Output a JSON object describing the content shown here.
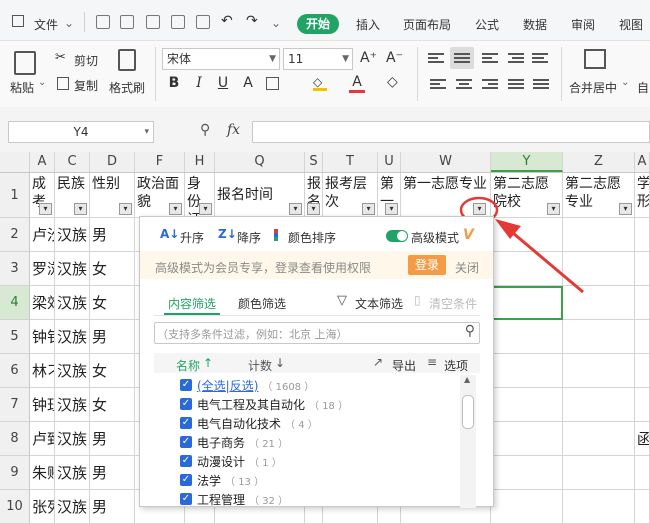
{
  "menubar": {
    "file_label": "文件",
    "tabs": [
      "开始",
      "插入",
      "页面布局",
      "公式",
      "数据",
      "审阅",
      "视图"
    ]
  },
  "ribbon": {
    "paste": "粘贴",
    "cut": "剪切",
    "copy": "复制",
    "format_painter": "格式刷",
    "font_name": "宋体",
    "font_size": "11",
    "bold": "B",
    "italic": "I",
    "underline": "U",
    "font_color_glyph": "A",
    "merge_center": "合并居中",
    "auto_wrap": "自"
  },
  "formula_bar": {
    "cell_ref": "Y4",
    "fx": "fx"
  },
  "grid": {
    "columns": [
      "A",
      "C",
      "D",
      "F",
      "H",
      "Q",
      "S",
      "T",
      "U",
      "W",
      "Y",
      "Z",
      "A"
    ],
    "header_row_num": "1",
    "headers": [
      "成考",
      "民族",
      "性别",
      "政治面貌",
      "身份证",
      "报名时间",
      "报名",
      "报考层次",
      "第一",
      "第一志愿专业",
      "第二志愿院校",
      "第二志愿专业",
      "学形"
    ],
    "rows": [
      {
        "num": "2",
        "a": "卢汐",
        "c": "汉族",
        "d": "男"
      },
      {
        "num": "3",
        "a": "罗浏",
        "c": "汉族",
        "d": "女"
      },
      {
        "num": "4",
        "a": "梁效",
        "c": "汉族",
        "d": "女"
      },
      {
        "num": "5",
        "a": "钟钅",
        "c": "汉族",
        "d": "男"
      },
      {
        "num": "6",
        "a": "林刁",
        "c": "汉族",
        "d": "女"
      },
      {
        "num": "7",
        "a": "钟珏",
        "c": "汉族",
        "d": "女"
      },
      {
        "num": "8",
        "a": "卢致",
        "c": "汉族",
        "d": "男",
        "last": "函"
      },
      {
        "num": "9",
        "a": "朱贱",
        "c": "汉族",
        "d": "男"
      },
      {
        "num": "10",
        "a": "张列",
        "c": "汉族",
        "d": "男"
      }
    ]
  },
  "filter_panel": {
    "sort_asc": "升序",
    "sort_desc": "降序",
    "color_sort": "颜色排序",
    "advanced_mode": "高级模式",
    "notice": "高级模式为会员专享，登录查看使用权限",
    "login": "登录",
    "close": "关闭",
    "tab_content": "内容筛选",
    "tab_color": "颜色筛选",
    "text_filter": "文本筛选",
    "clear_condition": "清空条件",
    "search_placeholder": "（支持多条件过滤，例如：北京 上海）",
    "col_name": "名称",
    "col_count": "计数",
    "export": "导出",
    "options": "选项",
    "items": [
      {
        "label": "(全选|反选)",
        "count": "（ 1608 ）"
      },
      {
        "label": "电气工程及其自动化",
        "count": "（ 18 ）"
      },
      {
        "label": "电气自动化技术",
        "count": "（ 4 ）"
      },
      {
        "label": "电子商务",
        "count": "（ 21 ）"
      },
      {
        "label": "动漫设计",
        "count": "（ 1 ）"
      },
      {
        "label": "法学",
        "count": "（ 13 ）"
      },
      {
        "label": "工程管理",
        "count": "（ 32 ）"
      }
    ]
  },
  "colors": {
    "accent_green": "#21a366",
    "annotation_red": "#e53935",
    "selection_green": "#3aa04a",
    "checkbox_blue": "#2a6ad8",
    "login_orange": "#f39c45"
  }
}
